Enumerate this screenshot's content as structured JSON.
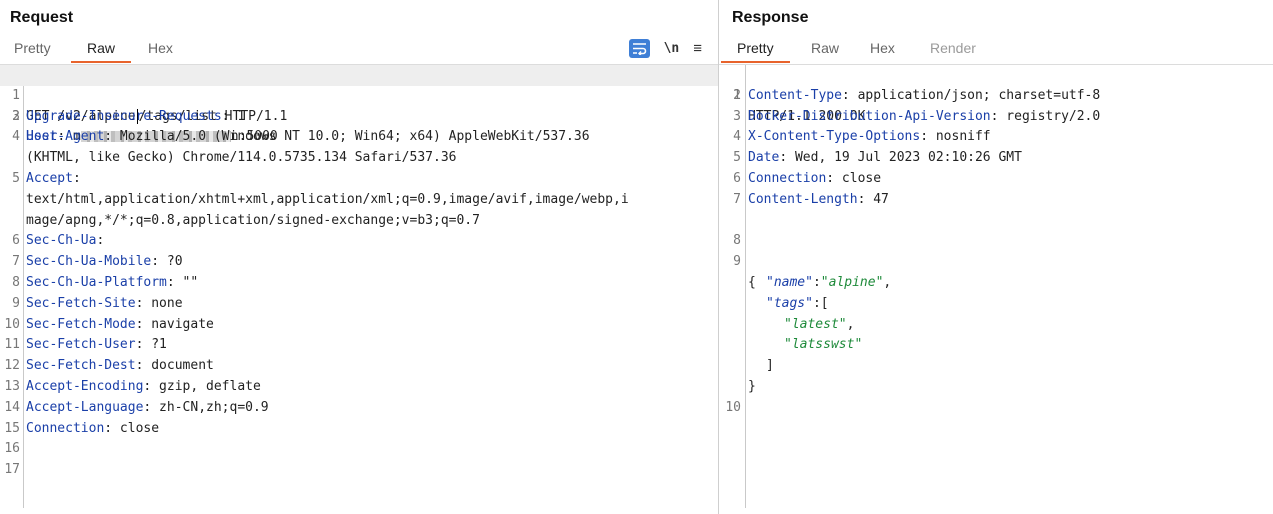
{
  "request": {
    "title": "Request",
    "tabs": [
      "Pretty",
      "Raw",
      "Hex"
    ],
    "active_tab": "Raw",
    "tools": {
      "wrap_icon": "word-wrap-icon",
      "newline_label": "\\n",
      "menu_icon": "hamburger-menu-icon"
    },
    "lines": [
      {
        "n": "1",
        "k": "",
        "v": "GET /v2/alpine"
      },
      {
        "n": "2",
        "k": "Host",
        "v": "m"
      },
      {
        "n": "3",
        "k": "Upgrade-Insecure-Requests",
        "v": ": 1"
      },
      {
        "n": "4",
        "k": "User-Agent",
        "v": ": Mozilla/5.0 (Windows NT 10.0; Win64; x64) AppleWebKit/537.36"
      },
      {
        "n": "",
        "k": "",
        "v": "(KHTML, like Gecko) Chrome/114.0.5735.134 Safari/537.36"
      },
      {
        "n": "5",
        "k": "Accept",
        "v": ":"
      },
      {
        "n": "",
        "k": "",
        "v": "text/html,application/xhtml+xml,application/xml;q=0.9,image/avif,image/webp,i"
      },
      {
        "n": "",
        "k": "",
        "v": "mage/apng,*/*;q=0.8,application/signed-exchange;v=b3;q=0.7"
      },
      {
        "n": "6",
        "k": "Sec-Ch-Ua",
        "v": ":"
      },
      {
        "n": "7",
        "k": "Sec-Ch-Ua-Mobile",
        "v": ": ?0"
      },
      {
        "n": "8",
        "k": "Sec-Ch-Ua-Platform",
        "v": ": \"\""
      },
      {
        "n": "9",
        "k": "Sec-Fetch-Site",
        "v": ": none"
      },
      {
        "n": "10",
        "k": "Sec-Fetch-Mode",
        "v": ": navigate"
      },
      {
        "n": "11",
        "k": "Sec-Fetch-User",
        "v": ": ?1"
      },
      {
        "n": "12",
        "k": "Sec-Fetch-Dest",
        "v": ": document"
      },
      {
        "n": "13",
        "k": "Accept-Encoding",
        "v": ": gzip, deflate"
      },
      {
        "n": "14",
        "k": "Accept-Language",
        "v": ": zh-CN,zh;q=0.9"
      },
      {
        "n": "15",
        "k": "Connection",
        "v": ": close"
      },
      {
        "n": "16",
        "k": "",
        "v": ""
      },
      {
        "n": "17",
        "k": "",
        "v": ""
      }
    ],
    "line1_rest": "/tags/list HTTP/1.1",
    "host_key": "Host",
    "host_prefix": ": m",
    "host_suffix": "n:5000"
  },
  "response": {
    "title": "Response",
    "tabs": [
      "Pretty",
      "Raw",
      "Hex",
      "Render"
    ],
    "active_tab": "Pretty",
    "status_line": "HTTP/1.1 200 OK",
    "headers": [
      {
        "n": "2",
        "k": "Content-Type",
        "v": ": application/json; charset=utf-8"
      },
      {
        "n": "3",
        "k": "Docker-Distribution-Api-Version",
        "v": ": registry/2.0"
      },
      {
        "n": "4",
        "k": "X-Content-Type-Options",
        "v": ": nosniff"
      },
      {
        "n": "5",
        "k": "Date",
        "v": ": Wed, 19 Jul 2023 02:10:26 GMT"
      },
      {
        "n": "6",
        "k": "Connection",
        "v": ": close"
      },
      {
        "n": "7",
        "k": "Content-Length",
        "v": ": 47"
      }
    ],
    "body": {
      "open_brace": "{",
      "name_key": "\"name\"",
      "name_val": "\"alpine\"",
      "tags_key": "\"tags\"",
      "tag1": "\"latest\"",
      "tag2": "\"latsswst\"",
      "close_bracket": "]",
      "close_brace": "}"
    },
    "line_numbers": [
      "1",
      "8",
      "9",
      "10"
    ]
  },
  "colors": {
    "accent": "#e8632c",
    "header_key": "#1a3fa8",
    "json_string": "#1e8a3a",
    "wrap_button": "#3f7fd6"
  }
}
